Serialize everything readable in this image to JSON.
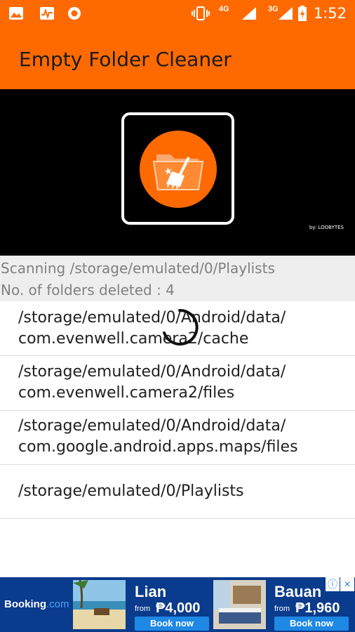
{
  "status_bar": {
    "time": "1:52",
    "network_1": "4G",
    "network_2": "3G",
    "icons": [
      "image-icon",
      "activity-icon",
      "record-icon",
      "vibrate-icon",
      "signal-icon",
      "signal-icon",
      "battery-icon"
    ]
  },
  "app_bar": {
    "title": "Empty Folder Cleaner"
  },
  "banner": {
    "byline": "by: LOOBYTES"
  },
  "scan": {
    "status": "Scanning /storage/emulated/0/Playlists",
    "deleted": "No. of folders deleted : 4"
  },
  "folders": [
    {
      "path": "/storage/emulated/0/Android/data/\ncom.evenwell.camera2/cache"
    },
    {
      "path": "/storage/emulated/0/Android/data/\ncom.evenwell.camera2/files"
    },
    {
      "path": "/storage/emulated/0/Android/data/\ncom.google.android.apps.maps/files"
    },
    {
      "path": "/storage/emulated/0/Playlists"
    }
  ],
  "ad": {
    "brand": "Booking",
    "brand_suffix": ".com",
    "offers": [
      {
        "city": "Lian",
        "from": "from",
        "price": "₱4,000",
        "cta": "Book now"
      },
      {
        "city": "Bauan",
        "from": "from",
        "price": "₱1,960",
        "cta": "Book now"
      }
    ],
    "info_icon": "ⓘ",
    "close_icon": "✕"
  },
  "colors": {
    "primary": "#ff6a00",
    "ad_bg": "#0a3b8c",
    "ad_button": "#1e88e5"
  }
}
